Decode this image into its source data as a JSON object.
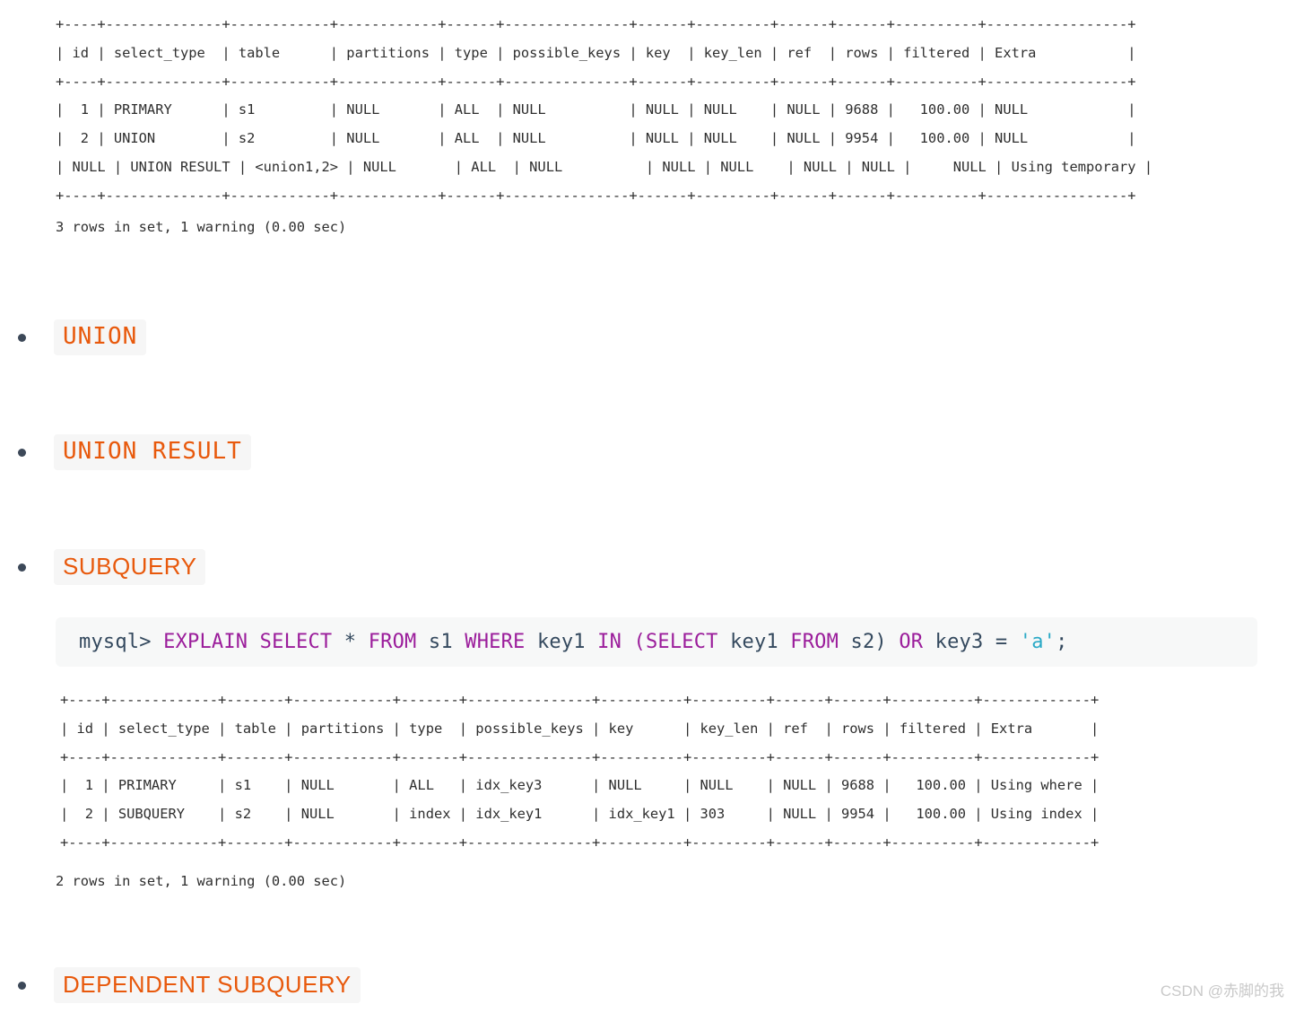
{
  "explain_output_1": {
    "lines": [
      "+----+--------------+------------+------------+------+---------------+------+---------+------+------+----------+-----------------+",
      "| id | select_type  | table      | partitions | type | possible_keys | key  | key_len | ref  | rows | filtered | Extra           |",
      "+----+--------------+------------+------------+------+---------------+------+---------+------+------+----------+-----------------+",
      "|  1 | PRIMARY      | s1         | NULL       | ALL  | NULL          | NULL | NULL    | NULL | 9688 |   100.00 | NULL            |",
      "|  2 | UNION        | s2         | NULL       | ALL  | NULL          | NULL | NULL    | NULL | 9954 |   100.00 | NULL            |",
      "| NULL | UNION RESULT | <union1,2> | NULL       | ALL  | NULL          | NULL | NULL    | NULL | NULL |     NULL | Using temporary |",
      "+----+--------------+------------+------------+------+---------------+------+---------+------+------+----------+-----------------+"
    ],
    "row_count_text": "3 rows in set, 1 warning (0.00 sec)"
  },
  "bullets": {
    "union": "UNION",
    "union_result": "UNION RESULT",
    "subquery": "SUBQUERY",
    "dependent_subquery": "DEPENDENT SUBQUERY"
  },
  "sql_block": {
    "tokens": [
      {
        "text": "mysql> ",
        "type": "plain"
      },
      {
        "text": "EXPLAIN SELECT",
        "type": "kw"
      },
      {
        "text": " * ",
        "type": "plain"
      },
      {
        "text": "FROM",
        "type": "kw"
      },
      {
        "text": " s1 ",
        "type": "plain"
      },
      {
        "text": "WHERE",
        "type": "kw"
      },
      {
        "text": " key1 ",
        "type": "plain"
      },
      {
        "text": "IN (SELECT",
        "type": "kw"
      },
      {
        "text": " key1 ",
        "type": "plain"
      },
      {
        "text": "FROM",
        "type": "kw"
      },
      {
        "text": " s2) ",
        "type": "plain"
      },
      {
        "text": "OR",
        "type": "kw"
      },
      {
        "text": " key3 = ",
        "type": "plain"
      },
      {
        "text": "'a'",
        "type": "str"
      },
      {
        "text": ";",
        "type": "plain"
      }
    ],
    "plain_text": "mysql> EXPLAIN SELECT * FROM s1 WHERE key1 IN (SELECT key1 FROM s2) OR key3 = 'a';"
  },
  "explain_output_2": {
    "lines": [
      "+----+-------------+-------+------------+-------+---------------+----------+---------+------+------+----------+-------------+",
      "| id | select_type | table | partitions | type  | possible_keys | key      | key_len | ref  | rows | filtered | Extra       |",
      "+----+-------------+-------+------------+-------+---------------+----------+---------+------+------+----------+-------------+",
      "|  1 | PRIMARY     | s1    | NULL       | ALL   | idx_key3      | NULL     | NULL    | NULL | 9688 |   100.00 | Using where |",
      "|  2 | SUBQUERY    | s2    | NULL       | index | idx_key1      | idx_key1 | 303     | NULL | 9954 |   100.00 | Using index |",
      "+----+-------------+-------+------------+-------+---------------+----------+---------+------+------+----------+-------------+"
    ],
    "row_count_text": "2 rows in set, 1 warning (0.00 sec)"
  },
  "table_data_1": {
    "columns": [
      "id",
      "select_type",
      "table",
      "partitions",
      "type",
      "possible_keys",
      "key",
      "key_len",
      "ref",
      "rows",
      "filtered",
      "Extra"
    ],
    "rows": [
      [
        "1",
        "PRIMARY",
        "s1",
        "NULL",
        "ALL",
        "NULL",
        "NULL",
        "NULL",
        "NULL",
        "9688",
        "100.00",
        "NULL"
      ],
      [
        "2",
        "UNION",
        "s2",
        "NULL",
        "ALL",
        "NULL",
        "NULL",
        "NULL",
        "NULL",
        "9954",
        "100.00",
        "NULL"
      ],
      [
        "NULL",
        "UNION RESULT",
        "<union1,2>",
        "NULL",
        "ALL",
        "NULL",
        "NULL",
        "NULL",
        "NULL",
        "NULL",
        "NULL",
        "Using temporary"
      ]
    ]
  },
  "table_data_2": {
    "columns": [
      "id",
      "select_type",
      "table",
      "partitions",
      "type",
      "possible_keys",
      "key",
      "key_len",
      "ref",
      "rows",
      "filtered",
      "Extra"
    ],
    "rows": [
      [
        "1",
        "PRIMARY",
        "s1",
        "NULL",
        "ALL",
        "idx_key3",
        "NULL",
        "NULL",
        "NULL",
        "9688",
        "100.00",
        "Using where"
      ],
      [
        "2",
        "SUBQUERY",
        "s2",
        "NULL",
        "index",
        "idx_key1",
        "idx_key1",
        "303",
        "NULL",
        "9954",
        "100.00",
        "Using index"
      ]
    ]
  },
  "watermark": {
    "text": "CSDN @赤脚的我"
  },
  "colors": {
    "accent_orange": "#e8590c",
    "code_bg": "#f7f8f8",
    "inline_code_bg": "#f6f6f6",
    "keyword_purple": "#9b1d9b",
    "string_cyan": "#2aa9c6",
    "plain_navy": "#34495e",
    "bullet": "#3c4858",
    "console_text": "#2f2f2f",
    "watermark": "#c9c9c9"
  }
}
